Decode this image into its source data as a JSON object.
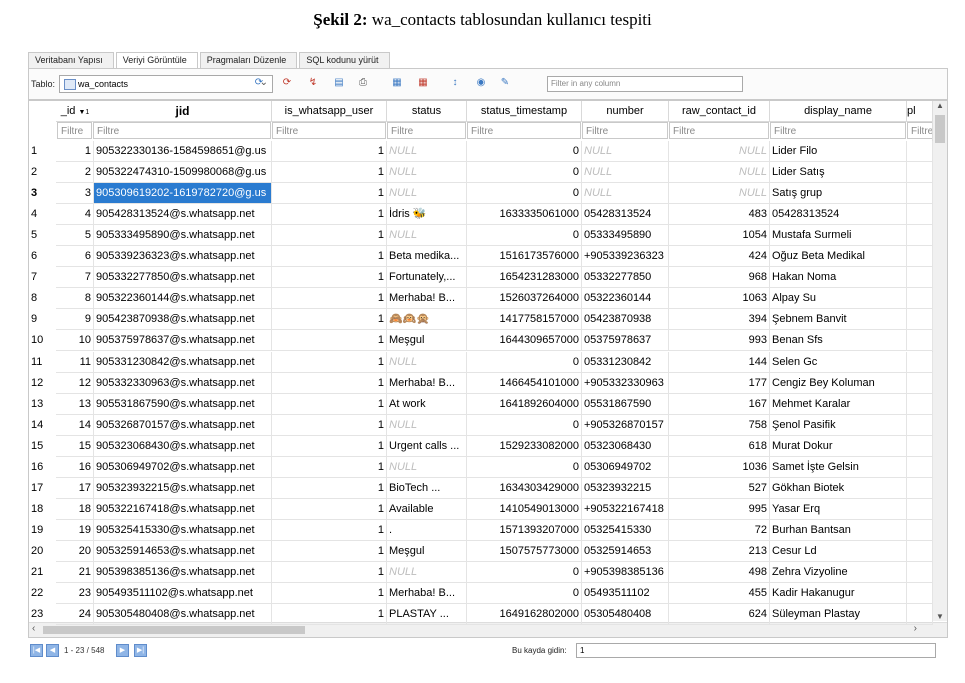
{
  "caption": {
    "prefix": "Şekil 2:",
    "text": "wa_contacts tablosundan kullanıcı tespiti"
  },
  "tabs": [
    {
      "label": "Veritabanı Yapısı",
      "active": false
    },
    {
      "label": "Veriyi Görüntüle",
      "active": true
    },
    {
      "label": "Pragmaları Düzenle",
      "active": false
    },
    {
      "label": "SQL kodunu yürüt",
      "active": false
    }
  ],
  "toolbar": {
    "table_label": "Tablo:",
    "table_value": "wa_contacts",
    "filter_placeholder": "Filter in any column"
  },
  "columns": [
    {
      "label": "_id",
      "sort": "▼1"
    },
    {
      "label": "jid"
    },
    {
      "label": "is_whatsapp_user"
    },
    {
      "label": "status"
    },
    {
      "label": "status_timestamp"
    },
    {
      "label": "number"
    },
    {
      "label": "raw_contact_id"
    },
    {
      "label": "display_name"
    },
    {
      "label": "pl"
    }
  ],
  "filter_placeholder": "Filtre",
  "null_text": "NULL",
  "rows": [
    {
      "rn": "1",
      "id": "1",
      "jid": "905322330136-1584598651@g.us",
      "wa": "1",
      "status": null,
      "ts": "0",
      "number": null,
      "raw": null,
      "name": "Lider Filo"
    },
    {
      "rn": "2",
      "id": "2",
      "jid": "905322474310-1509980068@g.us",
      "wa": "1",
      "status": null,
      "ts": "0",
      "number": null,
      "raw": null,
      "name": "Lider Satış"
    },
    {
      "rn": "3",
      "id": "3",
      "jid": "905309619202-1619782720@g.us",
      "wa": "1",
      "status": null,
      "ts": "0",
      "number": null,
      "raw": null,
      "name": "Satış grup",
      "selected": true
    },
    {
      "rn": "4",
      "id": "4",
      "jid": "905428313524@s.whatsapp.net",
      "wa": "1",
      "status": "İdris 🐝",
      "ts": "1633335061000",
      "number": "05428313524",
      "raw": "483",
      "name": "05428313524"
    },
    {
      "rn": "5",
      "id": "5",
      "jid": "905333495890@s.whatsapp.net",
      "wa": "1",
      "status": null,
      "ts": "0",
      "number": "05333495890",
      "raw": "1054",
      "name": "Mustafa Surmeli"
    },
    {
      "rn": "6",
      "id": "6",
      "jid": "905339236323@s.whatsapp.net",
      "wa": "1",
      "status": "Beta medika...",
      "ts": "1516173576000",
      "number": "+905339236323",
      "raw": "424",
      "name": "Oğuz Beta Medikal"
    },
    {
      "rn": "7",
      "id": "7",
      "jid": "905332277850@s.whatsapp.net",
      "wa": "1",
      "status": "Fortunately,...",
      "ts": "1654231283000",
      "number": "05332277850",
      "raw": "968",
      "name": "Hakan Noma"
    },
    {
      "rn": "8",
      "id": "8",
      "jid": "905322360144@s.whatsapp.net",
      "wa": "1",
      "status": "Merhaba! B...",
      "ts": "1526037264000",
      "number": "05322360144",
      "raw": "1063",
      "name": "Alpay Su"
    },
    {
      "rn": "9",
      "id": "9",
      "jid": "905423870938@s.whatsapp.net",
      "wa": "1",
      "status": "🙈🙉🙊",
      "ts": "1417758157000",
      "number": "05423870938",
      "raw": "394",
      "name": "Şebnem Banvit"
    },
    {
      "rn": "10",
      "id": "10",
      "jid": "905375978637@s.whatsapp.net",
      "wa": "1",
      "status": "Meşgul",
      "ts": "1644309657000",
      "number": "05375978637",
      "raw": "993",
      "name": "Benan Sfs"
    },
    {
      "rn": "11",
      "id": "11",
      "jid": "905331230842@s.whatsapp.net",
      "wa": "1",
      "status": null,
      "ts": "0",
      "number": "05331230842",
      "raw": "144",
      "name": "Selen Gc"
    },
    {
      "rn": "12",
      "id": "12",
      "jid": "905332330963@s.whatsapp.net",
      "wa": "1",
      "status": "Merhaba! B...",
      "ts": "1466454101000",
      "number": "+905332330963",
      "raw": "177",
      "name": "Cengiz Bey Koluman"
    },
    {
      "rn": "13",
      "id": "13",
      "jid": "905531867590@s.whatsapp.net",
      "wa": "1",
      "status": "At work",
      "ts": "1641892604000",
      "number": "05531867590",
      "raw": "167",
      "name": "Mehmet Karalar"
    },
    {
      "rn": "14",
      "id": "14",
      "jid": "905326870157@s.whatsapp.net",
      "wa": "1",
      "status": null,
      "ts": "0",
      "number": "+905326870157",
      "raw": "758",
      "name": "Şenol Pasifik"
    },
    {
      "rn": "15",
      "id": "15",
      "jid": "905323068430@s.whatsapp.net",
      "wa": "1",
      "status": "Urgent calls ...",
      "ts": "1529233082000",
      "number": "05323068430",
      "raw": "618",
      "name": "Murat Dokur"
    },
    {
      "rn": "16",
      "id": "16",
      "jid": "905306949702@s.whatsapp.net",
      "wa": "1",
      "status": null,
      "ts": "0",
      "number": "05306949702",
      "raw": "1036",
      "name": "Samet İşte Gelsin"
    },
    {
      "rn": "17",
      "id": "17",
      "jid": "905323932215@s.whatsapp.net",
      "wa": "1",
      "status": "BioTech ...",
      "ts": "1634303429000",
      "number": "05323932215",
      "raw": "527",
      "name": "Gökhan Biotek"
    },
    {
      "rn": "18",
      "id": "18",
      "jid": "905322167418@s.whatsapp.net",
      "wa": "1",
      "status": "Available",
      "ts": "1410549013000",
      "number": "+905322167418",
      "raw": "995",
      "name": "Yasar Erq"
    },
    {
      "rn": "19",
      "id": "19",
      "jid": "905325415330@s.whatsapp.net",
      "wa": "1",
      "status": ".",
      "ts": "1571393207000",
      "number": "05325415330",
      "raw": "72",
      "name": "Burhan Bantsan"
    },
    {
      "rn": "20",
      "id": "20",
      "jid": "905325914653@s.whatsapp.net",
      "wa": "1",
      "status": "Meşgul",
      "ts": "1507575773000",
      "number": "05325914653",
      "raw": "213",
      "name": "Cesur Ld"
    },
    {
      "rn": "21",
      "id": "21",
      "jid": "905398385136@s.whatsapp.net",
      "wa": "1",
      "status": null,
      "ts": "0",
      "number": "+905398385136",
      "raw": "498",
      "name": "Zehra Vizyoline"
    },
    {
      "rn": "22",
      "id": "23",
      "jid": "905493511102@s.whatsapp.net",
      "wa": "1",
      "status": "Merhaba! B...",
      "ts": "0",
      "number": "05493511102",
      "raw": "455",
      "name": "Kadir Hakanugur"
    },
    {
      "rn": "23",
      "id": "24",
      "jid": "905305480408@s.whatsapp.net",
      "wa": "1",
      "status": "PLASTAY ...",
      "ts": "1649162802000",
      "number": "05305480408",
      "raw": "624",
      "name": "Süleyman Plastay"
    }
  ],
  "footer": {
    "pager": "1 - 23 / 548",
    "goto_label": "Bu kayda gidin:",
    "goto_value": "1"
  },
  "colors": {
    "selection": "#2a7bd0",
    "null_text": "#bdbdbd"
  }
}
